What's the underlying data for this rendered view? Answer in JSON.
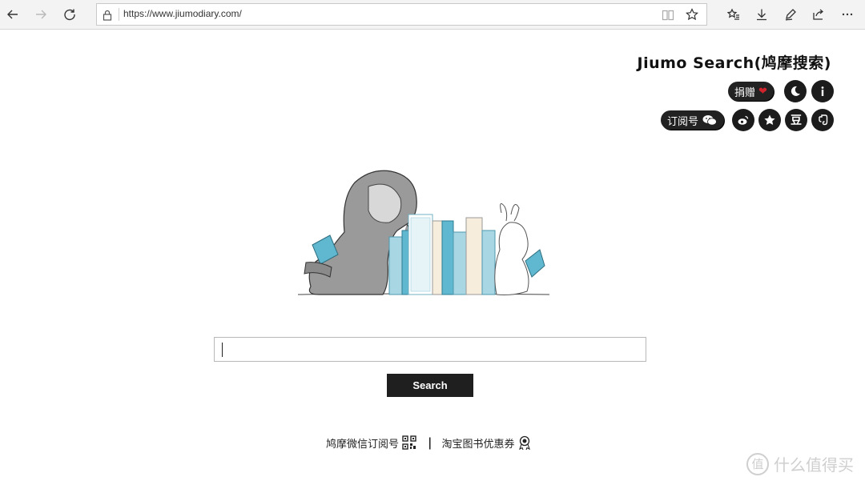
{
  "browser": {
    "url": "https://www.jiumodiary.com/"
  },
  "header": {
    "site_title": "Jiumo Search(鸠摩搜索)",
    "donate_label": "捐赠",
    "subscribe_label": "订阅号",
    "douban_label": "豆"
  },
  "search": {
    "input_value": "",
    "button_label": "Search"
  },
  "footer": {
    "wechat_link": "鸠摩微信订阅号",
    "divider": "|",
    "taobao_link": "淘宝图书优惠券"
  },
  "watermark": {
    "logo_char": "值",
    "text": "什么值得买"
  },
  "colors": {
    "toolbar_bg": "#f3f3f3",
    "button_dark": "#1f1f1f",
    "heart": "#d0232b",
    "book_teal": "#5fb8cf"
  }
}
